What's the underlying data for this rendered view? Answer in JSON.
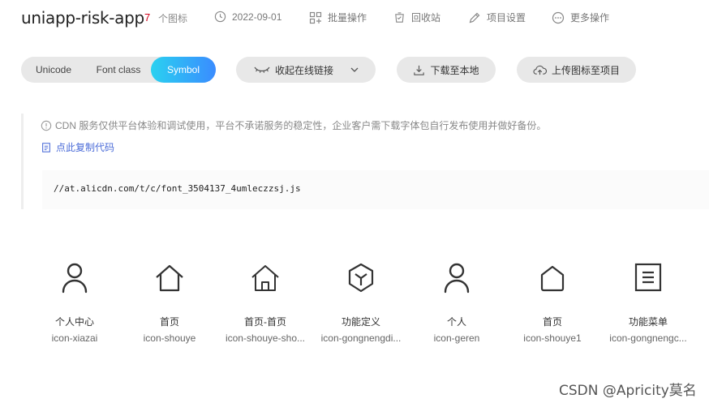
{
  "header": {
    "project_name": "uniapp-risk-app",
    "icon_count": "7",
    "icon_count_label": "个图标",
    "date": "2022-09-01",
    "batch_label": "批量操作",
    "recycle_label": "回收站",
    "settings_label": "项目设置",
    "more_label": "更多操作"
  },
  "toolbar": {
    "tabs": [
      {
        "label": "Unicode"
      },
      {
        "label": "Font class"
      },
      {
        "label": "Symbol"
      }
    ],
    "active_tab": "Symbol",
    "collect_label": "收起在线链接",
    "download_label": "下载至本地",
    "upload_label": "上传图标至项目"
  },
  "cdn": {
    "tip": "CDN 服务仅供平台体验和调试使用，平台不承诺服务的稳定性，企业客户需下载字体包自行发布使用并做好备份。",
    "copy_label": "点此复制代码",
    "code": "//at.alicdn.com/t/c/font_3504137_4umleczzsj.js"
  },
  "icons": [
    {
      "name": "个人中心",
      "code": "icon-xiazai",
      "glyph": "user-icon"
    },
    {
      "name": "首页",
      "code": "icon-shouye",
      "glyph": "home-icon"
    },
    {
      "name": "首页-首页",
      "code": "icon-shouye-sho...",
      "glyph": "home-door-icon"
    },
    {
      "name": "功能定义",
      "code": "icon-gongnengdi...",
      "glyph": "cube-icon"
    },
    {
      "name": "个人",
      "code": "icon-geren",
      "glyph": "person-icon"
    },
    {
      "name": "首页",
      "code": "icon-shouye1",
      "glyph": "house-outline-icon"
    },
    {
      "name": "功能菜单",
      "code": "icon-gongnengc...",
      "glyph": "menu-list-icon"
    }
  ],
  "watermark": "CSDN @Apricity莫名",
  "colors": {
    "accent_start": "#2ad1f0",
    "accent_end": "#3a8cff",
    "link": "#4a6bd8",
    "count": "#d0021b"
  }
}
